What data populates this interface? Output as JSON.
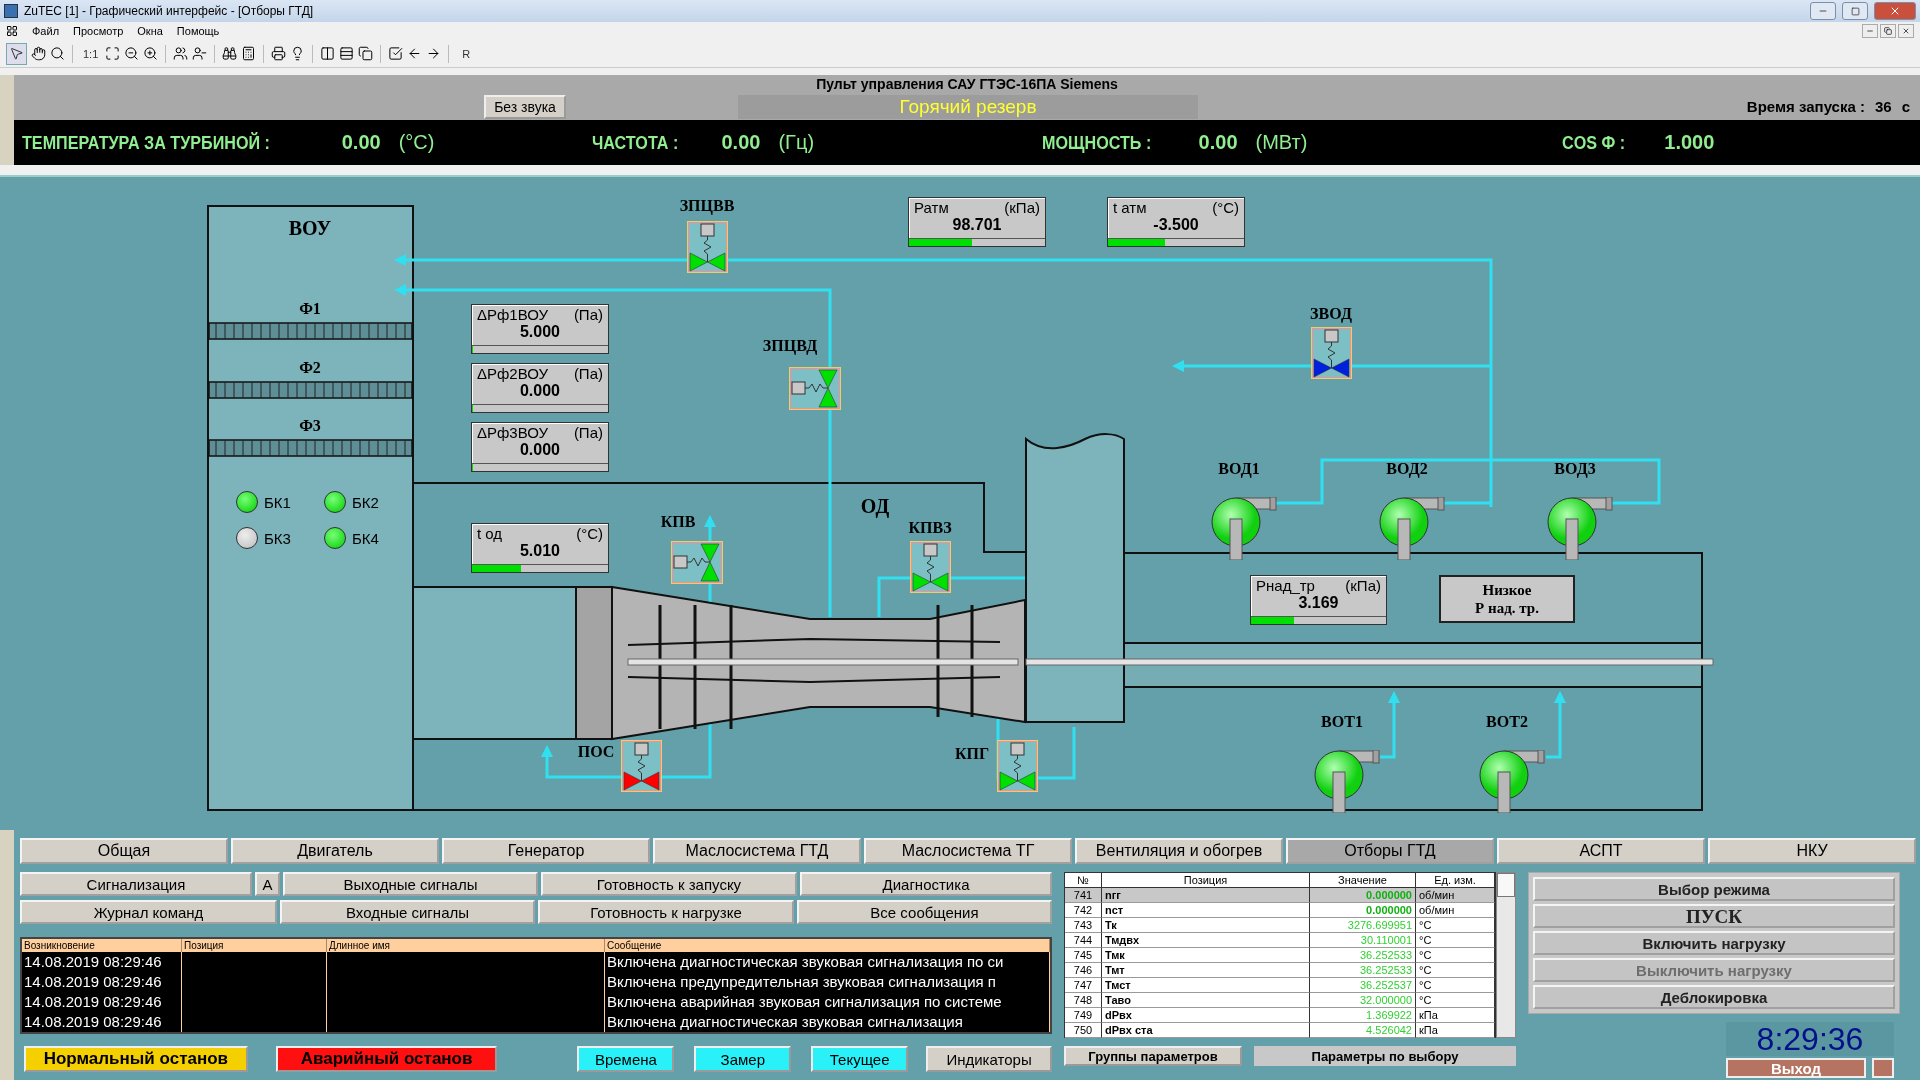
{
  "window": {
    "title": "ZuTEC [1] - Графический интерфейс - [Отборы ГТД]"
  },
  "menu": [
    "Файл",
    "Просмотр",
    "Окна",
    "Помощь"
  ],
  "toolbar": {
    "actual_size_label": "1:1",
    "reset_label": "R"
  },
  "header": {
    "title": "Пульт управления САУ ГТЭС-16ПА Siemens",
    "sound_button": "Без звука",
    "status": "Горячий резерв",
    "start_time_label": "Время запуска :",
    "start_time_value": "36",
    "start_time_unit": "с",
    "readings": [
      {
        "label": "ТЕМПЕРАТУРА ЗА ТУРБИНОЙ :",
        "value": "0.00",
        "unit": "(°C)"
      },
      {
        "label": "ЧАСТОТА :",
        "value": "0.00",
        "unit": "(Гц)"
      },
      {
        "label": "МОЩНОСТЬ :",
        "value": "0.00",
        "unit": "(МВт)"
      },
      {
        "label": "COS Ф :",
        "value": "1.000"
      }
    ]
  },
  "diagram": {
    "filter_unit": {
      "label": "ВОУ",
      "filters": [
        "Ф1",
        "Ф2",
        "Ф3"
      ],
      "lamps": [
        {
          "label": "БК1",
          "on": true
        },
        {
          "label": "БК2",
          "on": true
        },
        {
          "label": "БК3",
          "on": false
        },
        {
          "label": "БК4",
          "on": true
        }
      ]
    },
    "zone_label": "ОД",
    "valves": [
      {
        "label": "ЗПЦВВ",
        "kind": "vertical",
        "color": "#00e000"
      },
      {
        "label": "ЗПЦВД",
        "kind": "horizontal",
        "color": "#00e000"
      },
      {
        "label": "КПВ",
        "kind": "horizontal",
        "color": "#00e000"
      },
      {
        "label": "КПВЗ",
        "kind": "vertical",
        "color": "#00e000"
      },
      {
        "label": "ПОС",
        "kind": "vertical",
        "color": "#ff0000"
      },
      {
        "label": "КПГ",
        "kind": "vertical",
        "color": "#00e000"
      },
      {
        "label": "ЗВОД",
        "kind": "vertical",
        "color": "#0020e0"
      }
    ],
    "gauges": [
      {
        "label": "Ратм",
        "unit": "(кПа)",
        "value": "98.701",
        "level": 0.46
      },
      {
        "label": "t атм",
        "unit": "(°C)",
        "value": "-3.500",
        "level": 0.42
      },
      {
        "label": "ΔРф1ВОУ",
        "unit": "(Па)",
        "value": "5.000",
        "level": 0
      },
      {
        "label": "ΔРф2ВОУ",
        "unit": "(Па)",
        "value": "0.000",
        "level": 0
      },
      {
        "label": "ΔРф3ВОУ",
        "unit": "(Па)",
        "value": "0.000",
        "level": 0
      },
      {
        "label": "t од",
        "unit": "(°C)",
        "value": "5.010",
        "level": 0.36
      },
      {
        "label": "Рнад_тр",
        "unit": "(кПа)",
        "value": "3.169",
        "level": 0.32
      }
    ],
    "alarm": {
      "lines": [
        "Низкое",
        "Р над. тр."
      ]
    },
    "pumps": [
      {
        "label": "ВОД1",
        "on": true
      },
      {
        "label": "ВОД2",
        "on": true
      },
      {
        "label": "ВОД3",
        "on": true
      },
      {
        "label": "ВОТ1",
        "on": true
      },
      {
        "label": "ВОТ2",
        "on": true
      }
    ]
  },
  "tabs": [
    {
      "label": "Общая",
      "selected": false
    },
    {
      "label": "Двигатель",
      "selected": false
    },
    {
      "label": "Генератор",
      "selected": false
    },
    {
      "label": "Маслосистема ГТД",
      "selected": false
    },
    {
      "label": "Маслосистема ТГ",
      "selected": false
    },
    {
      "label": "Вентиляция и обогрев",
      "selected": false
    },
    {
      "label": "Отборы ГТД",
      "selected": true
    },
    {
      "label": "АСПТ",
      "selected": false
    },
    {
      "label": "НКУ",
      "selected": false
    }
  ],
  "nav_rows": [
    [
      "Сигнализация",
      "А",
      "Выходные сигналы",
      "Готовность к запуску",
      "Диагностика"
    ],
    [
      "Журнал команд",
      "Входные сигналы",
      "Готовность к нагрузке",
      "Все сообщения"
    ]
  ],
  "log": {
    "columns": [
      "Возникновение",
      "Позиция",
      "Длинное имя",
      "Сообщение"
    ],
    "rows": [
      {
        "time": "14.08.2019 08:29:46",
        "message": "Включена диагностическая звуковая сигнализация по си"
      },
      {
        "time": "14.08.2019 08:29:46",
        "message": "Включена предупредительная звуковая сигнализация п"
      },
      {
        "time": "14.08.2019 08:29:46",
        "message": "Включена аварийная звуковая сигнализация по системе"
      },
      {
        "time": "14.08.2019 08:29:46",
        "message": "Включена диагностическая звуковая сигнализация"
      }
    ]
  },
  "bottom_buttons": [
    {
      "label": "Нормальный останов",
      "kind": "warning"
    },
    {
      "label": "Аварийный останов",
      "kind": "danger"
    },
    {
      "label": "Времена",
      "kind": "info"
    },
    {
      "label": "Замер",
      "kind": "info"
    },
    {
      "label": "Текущее",
      "kind": "info"
    },
    {
      "label": "Индикаторы",
      "kind": "plain"
    }
  ],
  "parameters": {
    "columns": [
      "№",
      "Позиция",
      "Значение",
      "Ед. изм."
    ],
    "rows": [
      {
        "no": "741",
        "name": "nгг",
        "value": "0.000000",
        "unit": "об/мин",
        "selected": true
      },
      {
        "no": "742",
        "name": "nст",
        "value": "0.000000",
        "unit": "об/мин",
        "selected": false
      },
      {
        "no": "743",
        "name": "Тк",
        "value": "3276.699951",
        "unit": "°C",
        "selected": false
      },
      {
        "no": "744",
        "name": "Тмдвх",
        "value": "30.110001",
        "unit": "°C",
        "selected": false
      },
      {
        "no": "745",
        "name": "Тмк",
        "value": "36.252533",
        "unit": "°C",
        "selected": false
      },
      {
        "no": "746",
        "name": "Тмт",
        "value": "36.252533",
        "unit": "°C",
        "selected": false
      },
      {
        "no": "747",
        "name": "Тмст",
        "value": "36.252537",
        "unit": "°C",
        "selected": false
      },
      {
        "no": "748",
        "name": "Таво",
        "value": "32.000000",
        "unit": "°C",
        "selected": false
      },
      {
        "no": "749",
        "name": "dPвх",
        "value": "1.369922",
        "unit": "кПа",
        "selected": false
      },
      {
        "no": "750",
        "name": "dPвх ста",
        "value": "4.526042",
        "unit": "кПа",
        "selected": false
      }
    ],
    "buttons": [
      {
        "label": "Группы параметров",
        "kind": "raised"
      },
      {
        "label": "Параметры по выбору",
        "kind": "flat"
      }
    ]
  },
  "control_buttons": [
    {
      "label": "Выбор режима",
      "kind": "normal",
      "disabled": false
    },
    {
      "label": "ПУСК",
      "kind": "main",
      "disabled": false
    },
    {
      "label": "Включить нагрузку",
      "kind": "normal",
      "disabled": false
    },
    {
      "label": "Выключить нагрузку",
      "kind": "normal",
      "disabled": true
    },
    {
      "label": "Деблокировка",
      "kind": "normal",
      "disabled": false
    }
  ],
  "clock": "8:29:36",
  "exit_button": "Выход"
}
